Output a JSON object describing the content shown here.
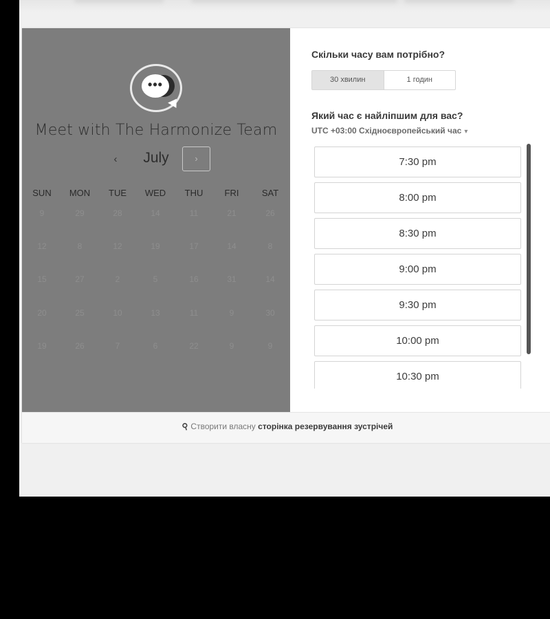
{
  "calendar": {
    "title": "Meet with The Harmonize Team",
    "month": "July",
    "prev_icon": "‹",
    "next_icon": "›",
    "weekdays": [
      "SUN",
      "MON",
      "TUE",
      "WED",
      "THU",
      "FRI",
      "SAT"
    ],
    "weeks": [
      [
        "9",
        "29",
        "28",
        "14",
        "11",
        "21",
        "26"
      ],
      [
        "12",
        "8",
        "12",
        "19",
        "17",
        "14",
        "8"
      ],
      [
        "15",
        "27",
        "2",
        "5",
        "16",
        "31",
        "14"
      ],
      [
        "20",
        "25",
        "10",
        "13",
        "11",
        "9",
        "30"
      ],
      [
        "19",
        "26",
        "7",
        "6",
        "22",
        "9",
        "9"
      ]
    ]
  },
  "booking": {
    "duration_question": "Скільки часу вам потрібно?",
    "durations": [
      "30 хвилин",
      "1 годин"
    ],
    "time_question": "Який час є найліпшим для вас?",
    "timezone": "UTC +03:00 Східноєвропейський час",
    "slots": [
      "7:30 pm",
      "8:00 pm",
      "8:30 pm",
      "9:00 pm",
      "9:30 pm",
      "10:00 pm",
      "10:30 pm"
    ]
  },
  "footer": {
    "prefix": "Створити власну",
    "link": "сторінка резервування зустрічей"
  }
}
